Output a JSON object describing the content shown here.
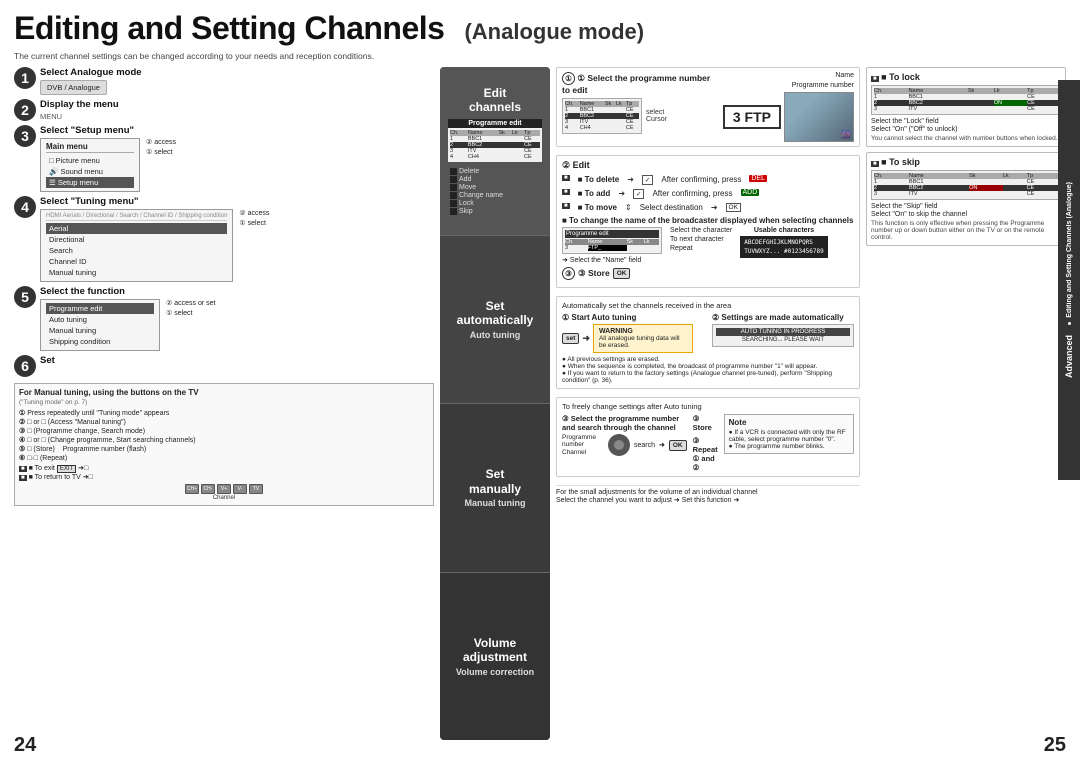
{
  "page": {
    "title": "Editing and Setting Channels",
    "subtitle": "(Analogue mode)",
    "intro": "The current channel settings can be changed according to your needs and reception conditions.",
    "page_num_left": "24",
    "page_num_right": "25",
    "edge_label_1": "● Editing and Setting Channels (Analogue)",
    "edge_label_2": "Advanced"
  },
  "steps": [
    {
      "number": "1",
      "title": "Select Analogue mode",
      "desc": "DVB / Analogue"
    },
    {
      "number": "2",
      "title": "Display the menu",
      "desc": "MENU"
    },
    {
      "number": "3",
      "title": "Select \"Setup menu\"",
      "desc": ""
    },
    {
      "number": "4",
      "title": "Select \"Tuning menu\"",
      "desc": ""
    },
    {
      "number": "5",
      "title": "Select the function",
      "desc": ""
    },
    {
      "number": "6",
      "title": "Set",
      "desc": ""
    }
  ],
  "main_menu": {
    "title": "Main menu",
    "items": [
      "Picture menu",
      "Sound menu",
      "Setup menu"
    ],
    "selected": "Setup menu",
    "access_label": "② access",
    "select_label": "① select"
  },
  "tuning_menu": {
    "title": "Tuning menu",
    "items": [
      "Aerial",
      "Directional",
      "Search",
      "Channel ID",
      "Manual tuning"
    ],
    "access_label": "② access",
    "select_label": "① select"
  },
  "middle_panel": {
    "edit_channels_title": "Edit\nchannels",
    "programme_edit_label": "Programme\nedit",
    "columns": [
      "Ch.",
      "Name",
      "Skip",
      "Lock",
      "Type"
    ],
    "rows": [
      [
        "1",
        "BBC1",
        "",
        "",
        "CE"
      ],
      [
        "2",
        "BBC2",
        "",
        "",
        "CE"
      ],
      [
        "3",
        "ITV",
        "",
        "",
        "CE"
      ],
      [
        "4",
        "CH4",
        "",
        "",
        "CE"
      ]
    ],
    "delete_label": "Delete",
    "add_label": "Add",
    "move_label": "Move",
    "change_name_label": "Change name",
    "lock_label": "Lock",
    "skip_label": "Skip",
    "set_automatically_title": "Set\nautomatically",
    "auto_tuning_label": "Auto tuning",
    "set_manually_title": "Set\nmanually",
    "manual_tuning_label": "Manual\ntuning",
    "volume_adjustment_title": "Volume\nadjustment",
    "volume_correction_label": "Volume\ncorrection"
  },
  "edit_section": {
    "title": "② Edit",
    "to_delete": "■ To delete",
    "after_confirming_delete": "After confirming, press",
    "to_add": "■ To add",
    "after_confirming_add": "After confirming, press",
    "to_move": "■ To move",
    "select_destination": "Select destination",
    "change_name_title": "■ To change the name of the broadcaster displayed when selecting channels",
    "select_name_field": "Select the \"Name\" field",
    "select_character": "Select the character",
    "to_next": "To next character",
    "repeat": "Repeat",
    "usable_chars": "Usable characters",
    "char_line1": "ABCDEFGHIJKLMNOPQRS",
    "char_line2": "TUVWXYZ... #0123456789"
  },
  "store_section": {
    "label": "③ Store",
    "ok": "OK"
  },
  "select_prog_section": {
    "title": "① Select the programme number to edit",
    "select_label": "select",
    "cursor_label": "Cursor",
    "programme_number_label": "Programme number",
    "name_label": "Name",
    "prog_display": "3  FTP"
  },
  "to_lock": {
    "title": "■ To lock",
    "select_lock_field": "Select the \"Lock\" field",
    "select_on": "Select \"On\" (\"Off\" to unlock)",
    "note": "You cannot select the channel with number buttons when locked."
  },
  "to_skip": {
    "title": "■ To skip",
    "select_skip_field": "Select the \"Skip\" field",
    "select_on": "Select \"On\" to skip the channel",
    "note": "This function is only effective when pressing the Programme number up or down button either on the TV or on the remote control."
  },
  "auto_tuning": {
    "section_title": "Automatically set the channels received in the area",
    "step1_title": "① Start Auto tuning",
    "step2_title": "② Settings are made automatically",
    "set_label": "set",
    "warning_title": "WARNING",
    "warning_text": "All analogue tuning data will be erased.",
    "note1": "● All previous settings are erased.",
    "note2": "● When the sequence is completed, the broadcast of programme number \"1\" will appear.",
    "note3": "● If you want to return to the factory settings (Analogue channel pre-tuned), perform \"Shipping condition\" (p. 36)."
  },
  "manual_tuning": {
    "section_title": "To freely change settings after Auto tuning",
    "step1_title": "③ Select the programme number and search through the channel",
    "step2_title": "③ Store",
    "step3_title": "③ Repeat ① and ②",
    "programme_label": "Programme number",
    "channel_label": "Channel",
    "search_label": "search",
    "note_title": "Note",
    "note_text": "● If a VCR is connected with only the RF cable, select programme number \"0\".",
    "blink_note": "● The programme number blinks."
  },
  "manual_buttons": {
    "title": "For Manual tuning, using the buttons on the TV",
    "subtitle": "(\"Tuning mode\" on p. 7)",
    "step1": "① Press repeatedly until \"Tuning mode\" appears",
    "step2": "② □ or □ (Access \"Manual tuning\")",
    "step3": "③ □ (Programme change, Search mode)",
    "step4": "④ □ or □ (Change programme, Start searching channels)",
    "step5": "⑤ □ (Store)   Programme number (flash)",
    "step6": "⑥ □ · □ (Repeat)",
    "to_exit": "■ To exit",
    "exit_btn": "EXIT",
    "to_return": "■ To return to TV"
  },
  "volume_adjustment": {
    "text": "For the small adjustments for the volume of an individual channel",
    "instruction": "Select the channel you want to adjust ➜ Set this function ➜"
  }
}
